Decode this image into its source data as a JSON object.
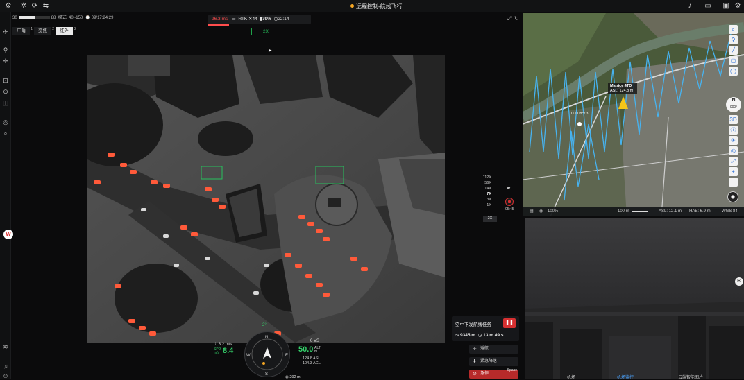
{
  "window": {
    "title": "远程控制-航线飞行"
  },
  "status": {
    "mode": "模式: 40~150",
    "time_label": "⌚ 09/17:24:29",
    "batt_left": "30",
    "batt_right": "88",
    "batt_level": 0.55
  },
  "telemetry": {
    "latency": "96.3 ms",
    "rtk_label": "RTK",
    "rtk_count": "44",
    "battery": "79%",
    "flight_time": "22:14"
  },
  "camera": {
    "modes": [
      {
        "label": "广角",
        "key": "1"
      },
      {
        "label": "变焦",
        "key": "2"
      },
      {
        "label": "红外",
        "key": "3"
      }
    ],
    "active_mode": 2,
    "zoom_badge": "2X",
    "zoom_levels": [
      "112X",
      "56X",
      "14X",
      "7X",
      "3X",
      "1X"
    ],
    "selected_zoom": "7X",
    "zoom_current": "2X",
    "rec_time": "05:45"
  },
  "map": {
    "aircraft": "Matrice 4TD",
    "aircraft_asl": "ASL: 124.8 m",
    "dock": "DJI Dock 3",
    "compass_dir": "N",
    "compass_deg": "000°",
    "mode_3d": "3D",
    "zoom_pct": "100%",
    "scale": "100 m",
    "asl": "ASL: 12.1 m",
    "hae": "HAE: 6.9 m",
    "datum": "WGS 84"
  },
  "mission": {
    "title": "空中下发航线任务",
    "distance": "9345 m",
    "duration": "13 m 49 s",
    "actions": [
      {
        "label": "返航"
      },
      {
        "label": "紧急降落"
      },
      {
        "label": "急停",
        "hotkey": "Space"
      }
    ]
  },
  "hud": {
    "speed_top": "3.2 m/s",
    "spd_label": "SPD m/s",
    "speed": "8.4",
    "alt": "50.0",
    "alt_label": "ALT m",
    "vs": "0 VS",
    "asl": "124.8 ASL",
    "agl": "104.3 AGL",
    "pitch": "2°",
    "distance": "292 m"
  },
  "sky_tabs": {
    "left": "机场",
    "mid": "机场监控",
    "right": "云端智能图片"
  }
}
